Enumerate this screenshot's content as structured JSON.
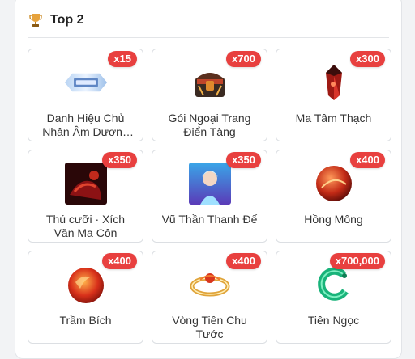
{
  "header": {
    "title": "Top 2",
    "icon": "trophy-icon"
  },
  "items": [
    {
      "name": "Danh Hiệu Chủ Nhân Âm Dương Giới",
      "qty": "x15",
      "icon": "title-banner-icon"
    },
    {
      "name": "Gói Ngoại Trang Điển Tàng",
      "qty": "x700",
      "icon": "treasure-chest-icon"
    },
    {
      "name": "Ma Tâm Thạch",
      "qty": "x300",
      "icon": "red-crystal-icon"
    },
    {
      "name": "Thú cưỡi · Xích Văn Ma Côn",
      "qty": "x350",
      "icon": "mount-portrait-icon"
    },
    {
      "name": "Vũ Thần Thanh Đế",
      "qty": "x350",
      "icon": "hero-portrait-icon"
    },
    {
      "name": "Hồng Mông",
      "qty": "x400",
      "icon": "red-orb-icon"
    },
    {
      "name": "Trầm Bích",
      "qty": "x400",
      "icon": "red-gem-icon"
    },
    {
      "name": "Vòng Tiên Chu Tước",
      "qty": "x400",
      "icon": "phoenix-ring-icon"
    },
    {
      "name": "Tiên Ngọc",
      "qty": "x700,000",
      "icon": "jade-coin-icon"
    }
  ]
}
